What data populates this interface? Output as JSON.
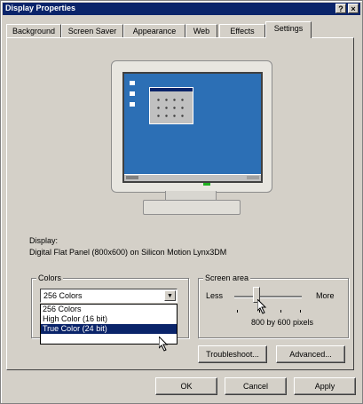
{
  "window": {
    "title": "Display Properties",
    "help_glyph": "?",
    "close_glyph": "×"
  },
  "tabs": [
    {
      "label": "Background"
    },
    {
      "label": "Screen Saver"
    },
    {
      "label": "Appearance"
    },
    {
      "label": "Web"
    },
    {
      "label": "Effects"
    },
    {
      "label": "Settings",
      "active": true
    }
  ],
  "display": {
    "label": "Display:",
    "value": "Digital Flat Panel (800x600) on Silicon Motion Lynx3DM"
  },
  "colors": {
    "group_title": "Colors",
    "selected": "256 Colors",
    "options": [
      "256 Colors",
      "High Color (16 bit)",
      "True Color (24 bit)"
    ],
    "highlighted_option": "True Color (24 bit)"
  },
  "screen_area": {
    "group_title": "Screen area",
    "less_label": "Less",
    "more_label": "More",
    "resolution_text": "800 by 600 pixels",
    "slider_fraction": 0.33
  },
  "buttons": {
    "troubleshoot": "Troubleshoot...",
    "advanced": "Advanced...",
    "ok": "OK",
    "cancel": "Cancel",
    "apply": "Apply"
  },
  "colors_theme": {
    "titlebar": "#0a246a",
    "face": "#d4d0c8",
    "desktop": "#2c6fb5",
    "selection": "#0a246a"
  }
}
